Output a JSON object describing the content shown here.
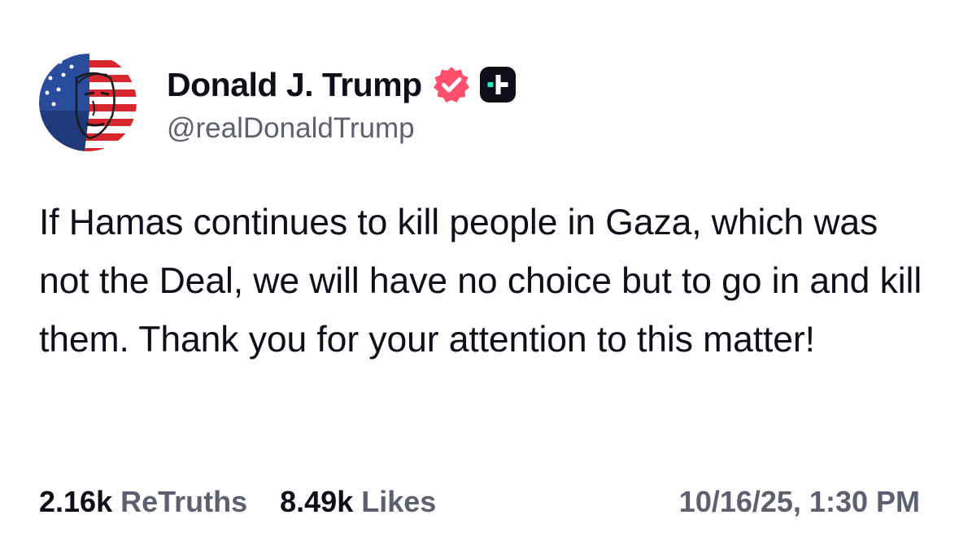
{
  "author": {
    "display_name": "Donald J. Trump",
    "handle": "@realDonaldTrump",
    "avatar_icon": "flag-portrait-avatar",
    "verified_icon": "verified-badge-icon",
    "plus_icon": "plus-badge-icon",
    "verified_color": "#ff4f6d",
    "plus_badge_color": "#0f0f1a",
    "plus_accent_color": "#2fe5c6"
  },
  "post": {
    "text": "If Hamas continues to kill people in Gaza, which was not the Deal, we will have no choice but to go in and kill them. Thank you for your attention to this matter!"
  },
  "stats": {
    "retruths_count": "2.16k",
    "retruths_label": "ReTruths",
    "likes_count": "8.49k",
    "likes_label": "Likes",
    "timestamp": "10/16/25, 1:30 PM"
  }
}
